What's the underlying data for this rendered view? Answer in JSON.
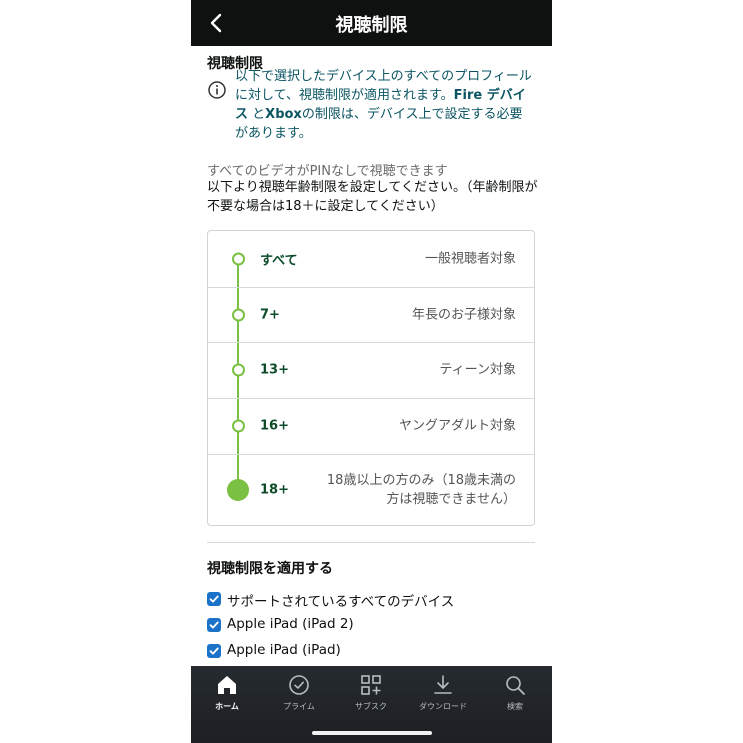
{
  "header": {
    "title": "視聴制限",
    "back_icon": "chevron-left-icon"
  },
  "section1_title": "視聴制限",
  "info": {
    "icon": "info-icon",
    "text_part1": "以下で選択したデバイス上のすべてのプロフィールに対して、視聴制限が適用されます。",
    "bold_fire": "Fire デバイス",
    "text_part2": "と",
    "bold_xbox": "Xbox",
    "text_part3": "の制限は、デバイス上で設定する必要があります。"
  },
  "status_text": "すべてのビデオがPINなしで視聴できます",
  "instruction_text": "以下より視聴年齢制限を設定してください。（年齢制限が不要な場合は18＋に設定してください）",
  "ratings": [
    {
      "label": "すべて",
      "desc": "一般視聴者対象"
    },
    {
      "label": "7+",
      "desc": "年長のお子様対象"
    },
    {
      "label": "13+",
      "desc": "ティーン対象"
    },
    {
      "label": "16+",
      "desc": "ヤングアダルト対象"
    },
    {
      "label": "18+",
      "desc_line1": "18歳以上の方のみ（18歳未満の",
      "desc_line2": "方は視聴できません）"
    }
  ],
  "selected_rating": "18+",
  "section2_title": "視聴制限を適用する",
  "devices": [
    {
      "label": "サポートされているすべてのデバイス",
      "checked": true
    },
    {
      "label": "Apple iPad (iPad 2)",
      "checked": true
    },
    {
      "label": "Apple iPad (iPad)",
      "checked": true
    }
  ],
  "tabs": [
    {
      "label": "ホーム",
      "icon": "home-icon",
      "active": true
    },
    {
      "label": "プライム",
      "icon": "check-circle-icon",
      "active": false
    },
    {
      "label": "サブスク",
      "icon": "grid-plus-icon",
      "active": false
    },
    {
      "label": "ダウンロード",
      "icon": "download-icon",
      "active": false
    },
    {
      "label": "検索",
      "icon": "search-icon",
      "active": false
    }
  ],
  "colors": {
    "accent_green": "#7ac143",
    "info_teal": "#0b5563",
    "checkbox_blue": "#1a73c9",
    "topbar": "#0f1111"
  }
}
